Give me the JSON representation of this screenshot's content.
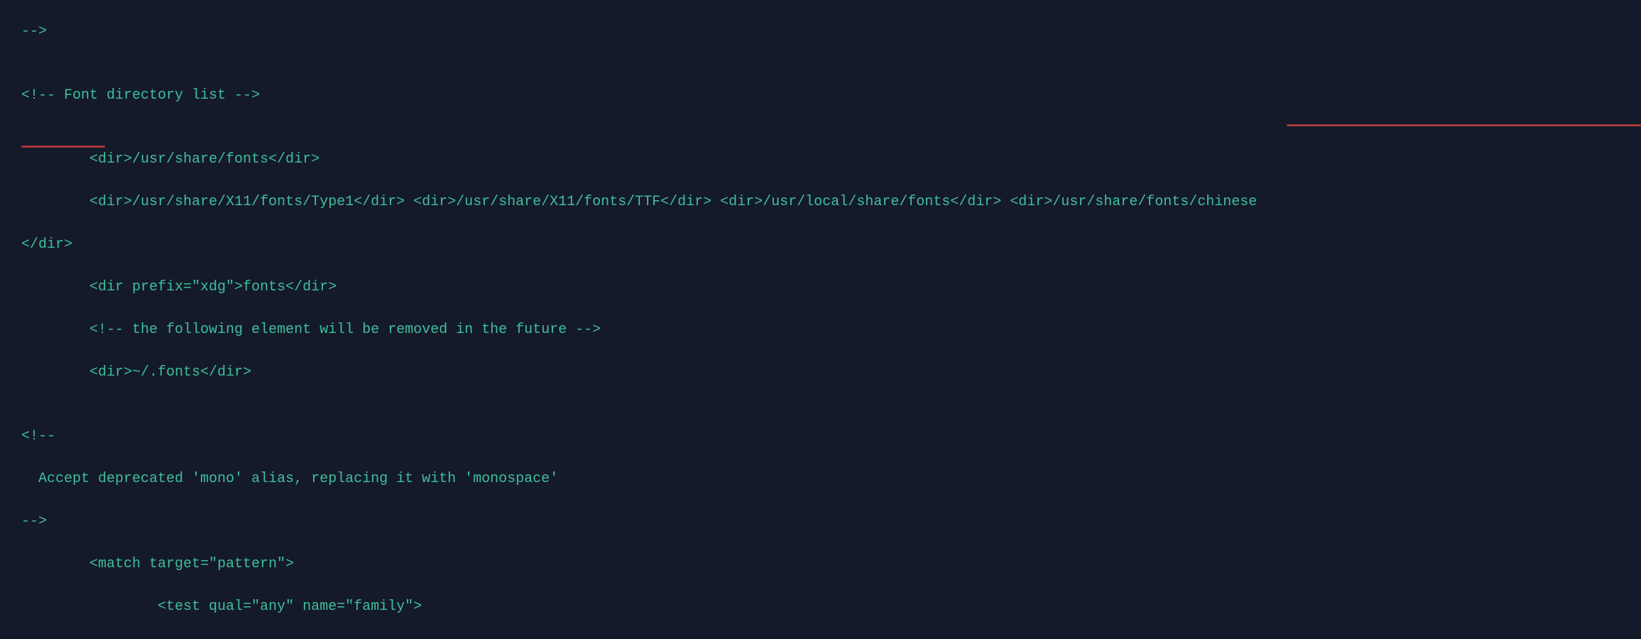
{
  "code": {
    "line1": "-->",
    "line2": "",
    "line3": "<!-- Font directory list -->",
    "line4": "",
    "line5": "        <dir>/usr/share/fonts</dir>",
    "line6": "        <dir>/usr/share/X11/fonts/Type1</dir> <dir>/usr/share/X11/fonts/TTF</dir> <dir>/usr/local/share/fonts</dir> <dir>/usr/share/fonts/chinese",
    "line7": "</dir>",
    "line8": "        <dir prefix=\"xdg\">fonts</dir>",
    "line9": "        <!-- the following element will be removed in the future -->",
    "line10": "        <dir>~/.fonts</dir>",
    "line11": "",
    "line12": "<!--",
    "line13": "  Accept deprecated 'mono' alias, replacing it with 'monospace'",
    "line14": "-->",
    "line15": "        <match target=\"pattern\">",
    "line16": "                <test qual=\"any\" name=\"family\">"
  }
}
